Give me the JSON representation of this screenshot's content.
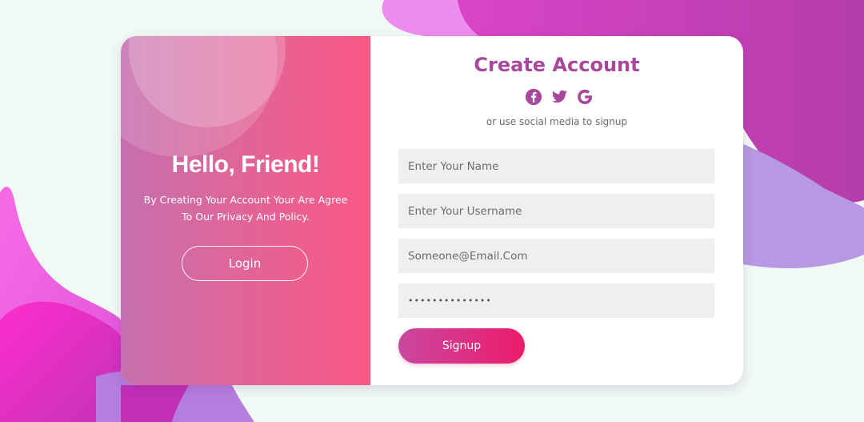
{
  "left_panel": {
    "title": "Hello, Friend!",
    "description_lines": [
      "By Creating Your Account Your Are Agree",
      "To Our Privacy And Policy."
    ],
    "login_label": "Login"
  },
  "right_panel": {
    "title": "Create Account",
    "social_icons": [
      "facebook-icon",
      "twitter-icon",
      "google-icon"
    ],
    "social_hint": "or use social media to signup",
    "fields": {
      "name_placeholder": "Enter Your Name",
      "username_placeholder": "Enter Your Username",
      "email_placeholder": "Someone@Email.Com",
      "password_value": "••••••••••••••"
    },
    "signup_label": "Signup"
  },
  "colors": {
    "accent_title": "#a9479e",
    "left_gradient_start": "#c56fae",
    "left_gradient_end": "#fa5885",
    "signup_gradient_start": "#c9489f",
    "signup_gradient_end": "#ec1b6b",
    "page_background": "#f0f9f4"
  }
}
